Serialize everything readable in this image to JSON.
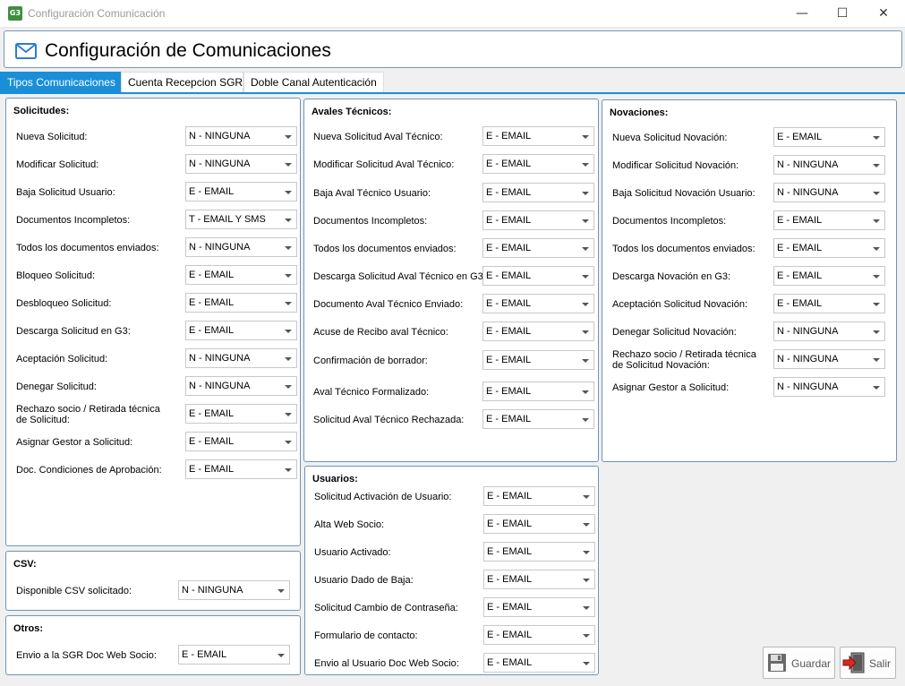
{
  "window": {
    "title": "Configuración Comunicación",
    "app_icon": "G3",
    "minimize": "—",
    "maximize": "☐",
    "close": "✕"
  },
  "header": {
    "title": "Configuración de Comunicaciones",
    "icon": "envelope-icon"
  },
  "tabs": [
    {
      "label": "Tipos Comunicaciones",
      "active": true
    },
    {
      "label": "Cuenta Recepcion SGR",
      "active": false
    },
    {
      "label": "Doble Canal Autenticación",
      "active": false
    }
  ],
  "solicitudes": {
    "title": "Solicitudes:",
    "rows": [
      {
        "label": "Nueva Solicitud:",
        "value": "N - NINGUNA"
      },
      {
        "label": "Modificar Solicitud:",
        "value": "N - NINGUNA"
      },
      {
        "label": "Baja Solicitud Usuario:",
        "value": "E - EMAIL"
      },
      {
        "label": "Documentos Incompletos:",
        "value": "T - EMAIL Y SMS"
      },
      {
        "label": "Todos los documentos enviados:",
        "value": "N - NINGUNA"
      },
      {
        "label": "Bloqueo Solicitud:",
        "value": "E - EMAIL"
      },
      {
        "label": "Desbloqueo Solicitud:",
        "value": "E - EMAIL"
      },
      {
        "label": "Descarga Solicitud en G3:",
        "value": "E - EMAIL"
      },
      {
        "label": "Aceptación Solicitud:",
        "value": "N - NINGUNA"
      },
      {
        "label": "Denegar Solicitud:",
        "value": "N - NINGUNA"
      },
      {
        "label": "Rechazo socio / Retirada técnica\nde Solicitud:",
        "value": "E - EMAIL"
      },
      {
        "label": "Asignar Gestor a Solicitud:",
        "value": "E - EMAIL"
      },
      {
        "label": "Doc. Condiciones de Aprobación:",
        "value": "E - EMAIL"
      }
    ]
  },
  "csv": {
    "title": "CSV:",
    "rows": [
      {
        "label": "Disponible CSV solicitado:",
        "value": "N - NINGUNA"
      }
    ]
  },
  "otros": {
    "title": "Otros:",
    "rows": [
      {
        "label": "Envio a la SGR Doc Web Socio:",
        "value": "E - EMAIL"
      }
    ]
  },
  "avales": {
    "title": "Avales Técnicos:",
    "rows": [
      {
        "label": "Nueva Solicitud Aval Técnico:",
        "value": "E - EMAIL"
      },
      {
        "label": "Modificar Solicitud Aval Técnico:",
        "value": "E - EMAIL"
      },
      {
        "label": "Baja Aval Técnico Usuario:",
        "value": "E - EMAIL"
      },
      {
        "label": "Documentos Incompletos:",
        "value": "E - EMAIL"
      },
      {
        "label": "Todos los documentos enviados:",
        "value": "E - EMAIL"
      },
      {
        "label": "Descarga Solicitud Aval Técnico en G3:",
        "value": "E - EMAIL"
      },
      {
        "label": "Documento Aval Técnico Enviado:",
        "value": "E - EMAIL"
      },
      {
        "label": "Acuse de Recibo aval Técnico:",
        "value": "E - EMAIL"
      },
      {
        "label": "Confirmación de borrador:",
        "value": "E - EMAIL"
      },
      {
        "label": "Aval Técnico Formalizado:",
        "value": "E - EMAIL"
      },
      {
        "label": "Solicitud Aval Técnico Rechazada:",
        "value": "E - EMAIL"
      }
    ]
  },
  "usuarios": {
    "title": "Usuarios:",
    "rows": [
      {
        "label": "Solicitud Activación de Usuario:",
        "value": "E - EMAIL"
      },
      {
        "label": "Alta Web Socio:",
        "value": "E - EMAIL"
      },
      {
        "label": "Usuario Activado:",
        "value": "E - EMAIL"
      },
      {
        "label": "Usuario Dado de Baja:",
        "value": "E - EMAIL"
      },
      {
        "label": "Solicitud Cambio de Contraseña:",
        "value": "E - EMAIL"
      },
      {
        "label": "Formulario de contacto:",
        "value": "E - EMAIL"
      },
      {
        "label": "Envio al Usuario Doc Web Socio:",
        "value": "E - EMAIL"
      }
    ]
  },
  "novaciones": {
    "title": "Novaciones:",
    "rows": [
      {
        "label": "Nueva Solicitud Novación:",
        "value": "E - EMAIL"
      },
      {
        "label": "Modificar Solicitud Novación:",
        "value": "N - NINGUNA"
      },
      {
        "label": "Baja Solicitud Novación Usuario:",
        "value": "N - NINGUNA"
      },
      {
        "label": "Documentos Incompletos:",
        "value": "E - EMAIL"
      },
      {
        "label": "Todos los documentos enviados:",
        "value": "E - EMAIL"
      },
      {
        "label": "Descarga Novación en G3:",
        "value": "E - EMAIL"
      },
      {
        "label": "Aceptación Solicitud Novación:",
        "value": "E - EMAIL"
      },
      {
        "label": "Denegar Solicitud Novación:",
        "value": "N - NINGUNA"
      },
      {
        "label": "Rechazo socio / Retirada técnica\nde Solicitud Novación:",
        "value": "N - NINGUNA"
      },
      {
        "label": "Asignar Gestor a Solicitud:",
        "value": "N - NINGUNA"
      }
    ]
  },
  "buttons": {
    "guardar": {
      "label": "Guardar",
      "icon": "floppy-disk-icon"
    },
    "salir": {
      "label": "Salir",
      "icon": "exit-door-icon"
    }
  },
  "colors": {
    "accent": "#1a8fd8",
    "panel_border": "#6e94b8"
  }
}
